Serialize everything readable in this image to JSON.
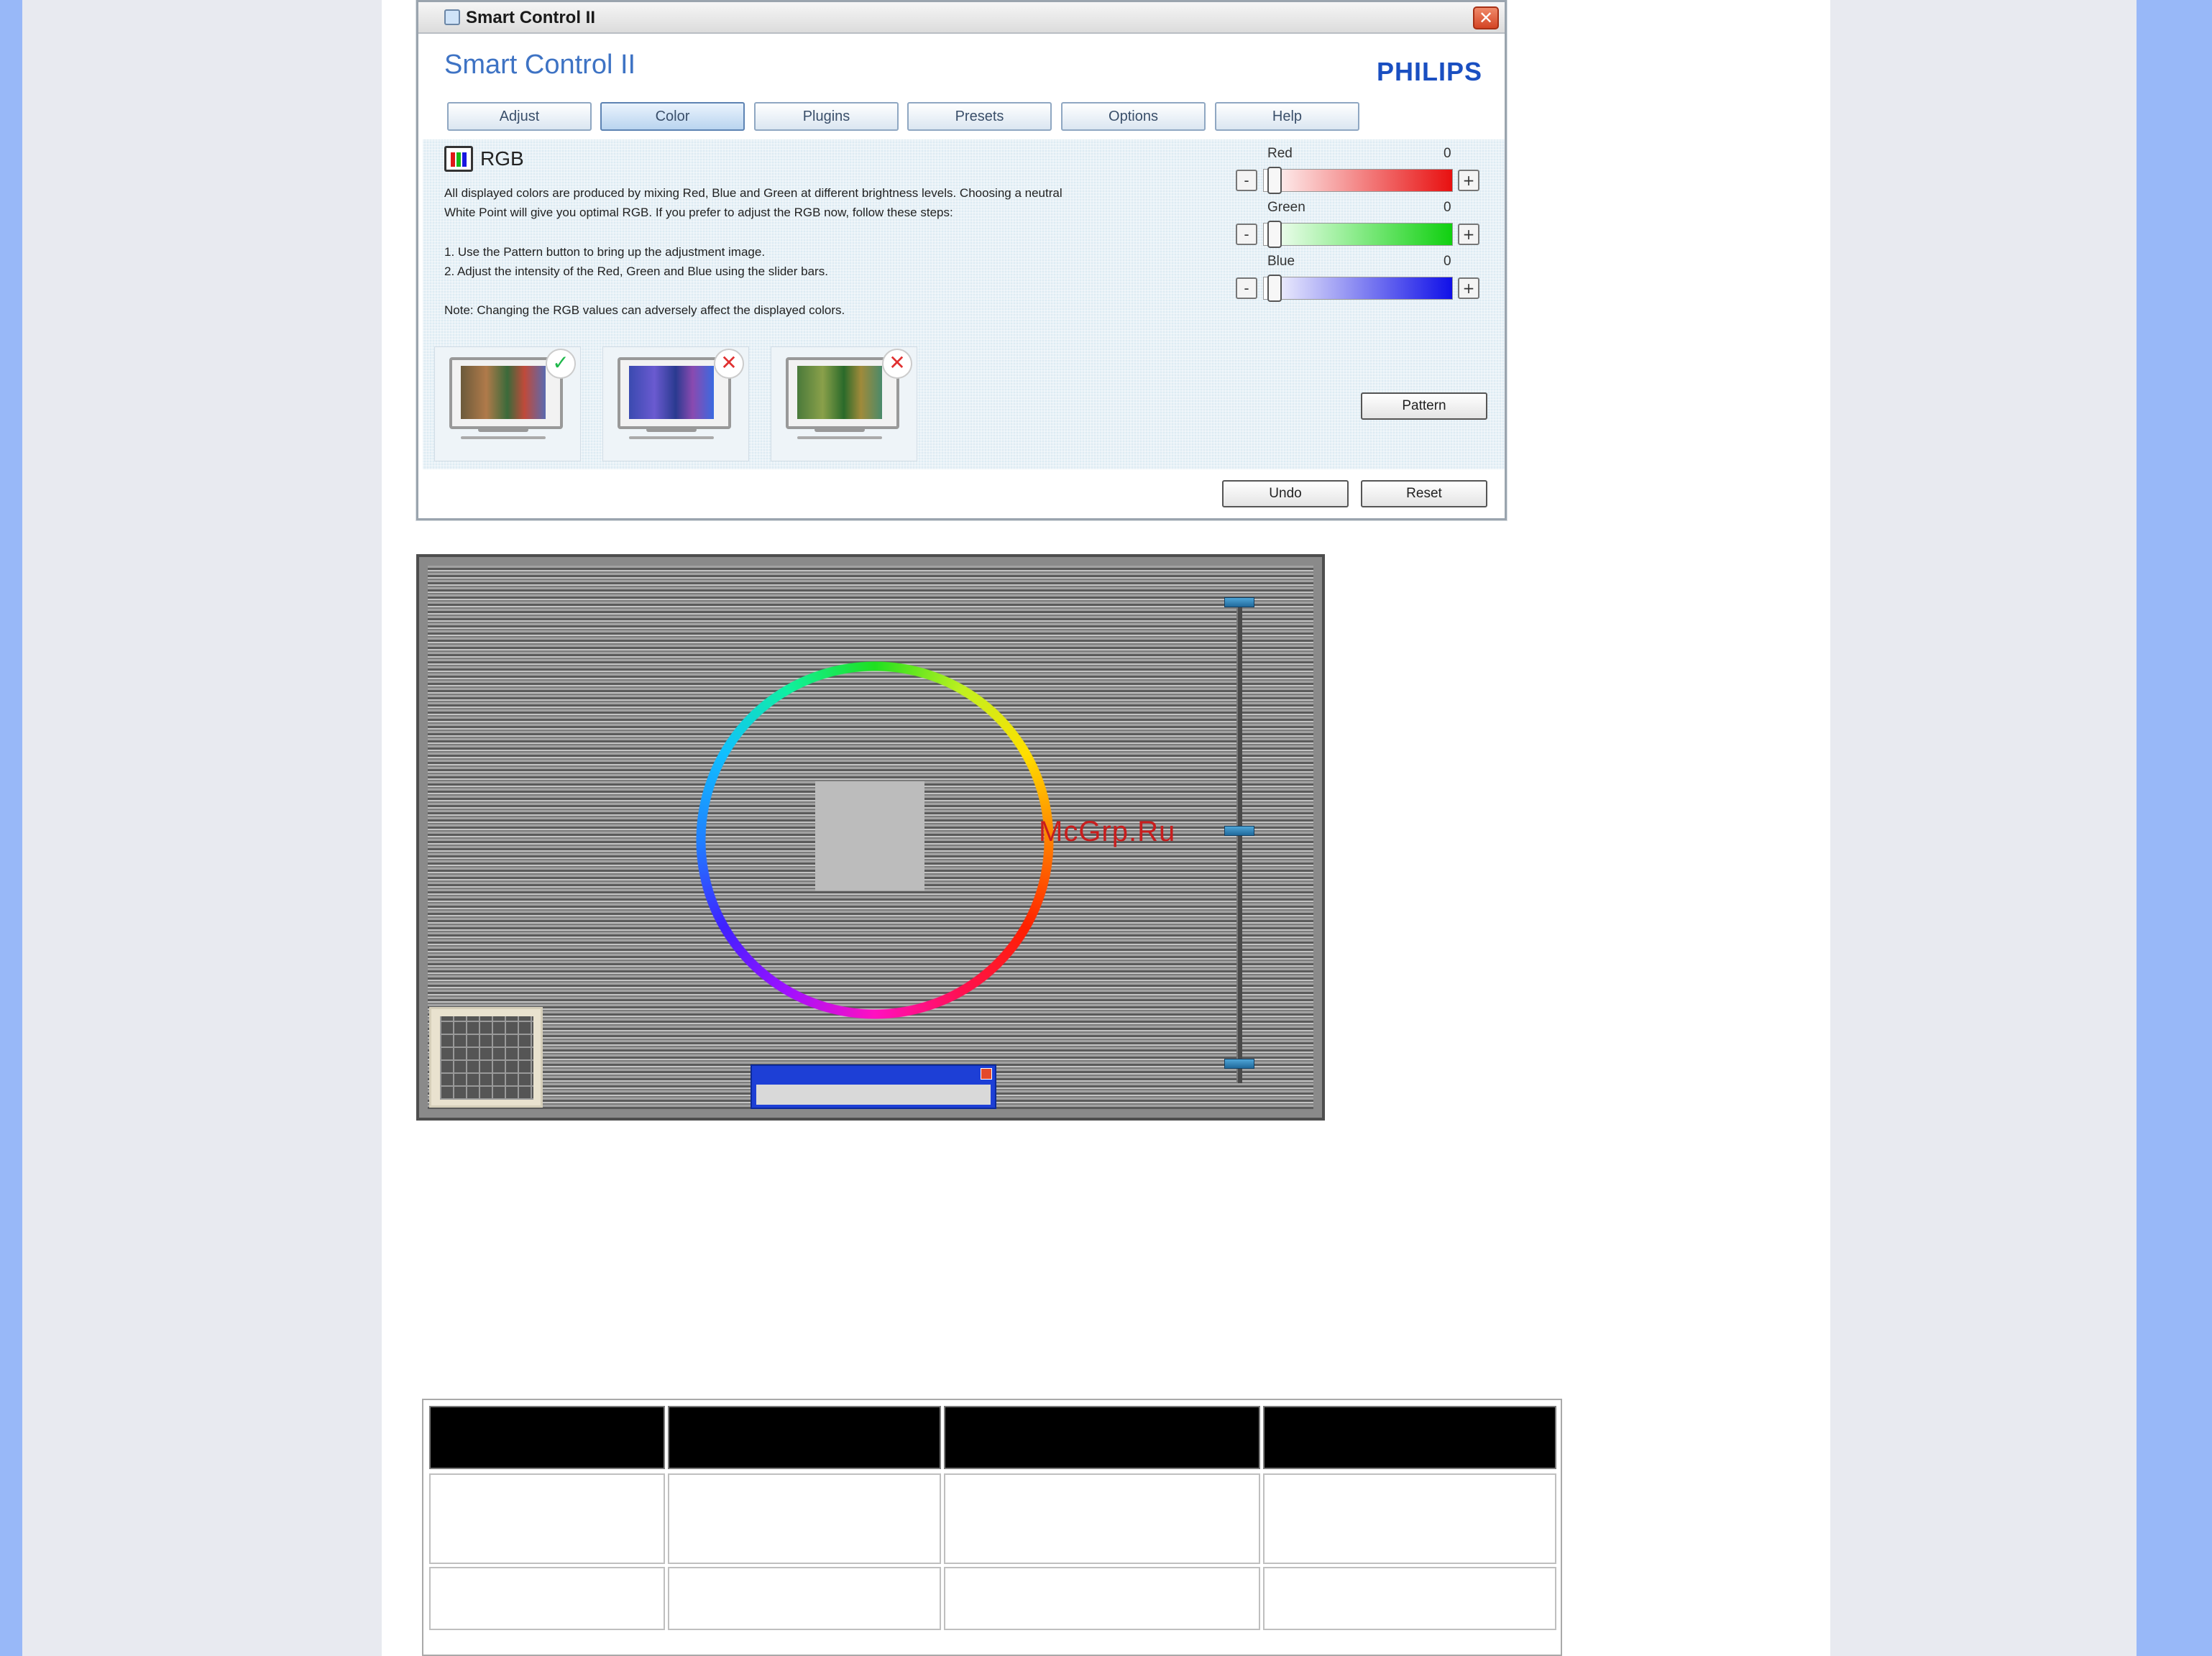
{
  "window": {
    "title": "Smart Control II",
    "heading": "Smart Control II",
    "brand": "PHILIPS",
    "close_glyph": "✕"
  },
  "tabs": [
    {
      "label": "Adjust",
      "active": false
    },
    {
      "label": "Color",
      "active": true
    },
    {
      "label": "Plugins",
      "active": false
    },
    {
      "label": "Presets",
      "active": false
    },
    {
      "label": "Options",
      "active": false
    },
    {
      "label": "Help",
      "active": false
    }
  ],
  "rgb_panel": {
    "title": "RGB",
    "intro_line1": "All displayed colors are produced by mixing Red, Blue and Green at different brightness levels. Choosing a neutral",
    "intro_line2": "White Point will give you optimal RGB. If you prefer to adjust the RGB now, follow these steps:",
    "step1": "1. Use the Pattern button to bring up the adjustment image.",
    "step2": "2. Adjust the intensity of the Red, Green and Blue using the slider bars.",
    "note": "Note: Changing the RGB values can adversely affect the displayed colors.",
    "examples": [
      {
        "status": "correct",
        "badge": "✓"
      },
      {
        "status": "incorrect",
        "badge": "✕"
      },
      {
        "status": "incorrect",
        "badge": "✕"
      }
    ]
  },
  "sliders": [
    {
      "label": "Red",
      "value": "0",
      "minus": "-",
      "plus": "+",
      "color": "#e81010"
    },
    {
      "label": "Green",
      "value": "0",
      "minus": "-",
      "plus": "+",
      "color": "#10d010"
    },
    {
      "label": "Blue",
      "value": "0",
      "minus": "-",
      "plus": "+",
      "color": "#1010e8"
    }
  ],
  "buttons": {
    "pattern": "Pattern",
    "undo": "Undo",
    "reset": "Reset"
  },
  "pattern_view": {
    "watermark": "McGrp.Ru"
  },
  "colors": {
    "rail": "#98b8f8",
    "band": "#e8eaf0",
    "accent": "#3e73c4"
  }
}
